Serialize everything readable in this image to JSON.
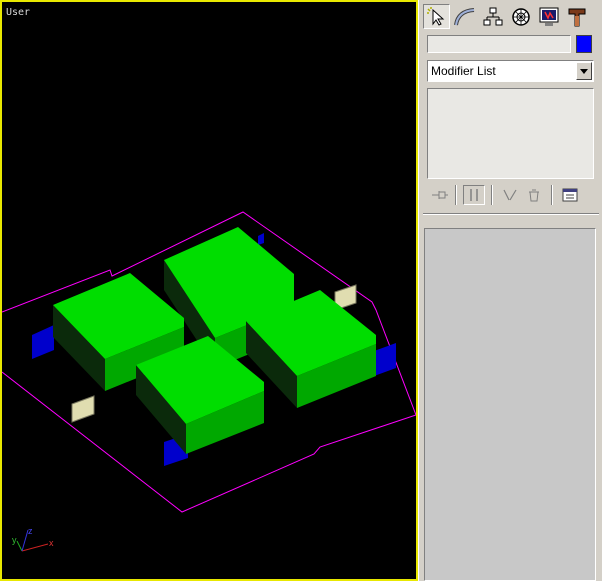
{
  "viewport": {
    "label": "User",
    "background": "#000000",
    "border_color": "#e8e800",
    "scene": {
      "box_top_color": "#00dd00",
      "box_side_color": "#00a800",
      "box_shadow_color": "#0b2a0b",
      "outline_color": "#ff00ff",
      "marker_blue": "#0000cc",
      "marker_beige": "#e0ddb0"
    },
    "axis": {
      "x": "x",
      "y": "y",
      "z": "z"
    }
  },
  "command_panel": {
    "tabs": [
      {
        "name": "create",
        "icon": "create-icon",
        "active": true
      },
      {
        "name": "modify",
        "icon": "modify-icon"
      },
      {
        "name": "hierarchy",
        "icon": "hierarchy-icon"
      },
      {
        "name": "motion",
        "icon": "motion-icon"
      },
      {
        "name": "display",
        "icon": "display-icon"
      },
      {
        "name": "utilities",
        "icon": "utilities-icon"
      }
    ],
    "object_name": "",
    "object_color": "#0000ff",
    "modifier_list": {
      "selected": "Modifier List"
    },
    "stack_toolbar": [
      {
        "icon": "pin-stack-icon"
      },
      {
        "icon": "show-end-result-icon",
        "pressed": true
      },
      {
        "icon": "make-unique-icon"
      },
      {
        "icon": "remove-modifier-icon"
      },
      {
        "icon": "configure-modifier-sets-icon"
      }
    ]
  }
}
